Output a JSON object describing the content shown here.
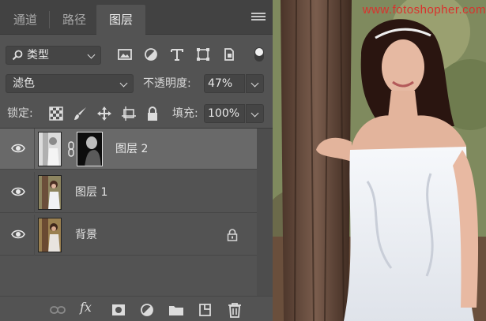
{
  "tabs": [
    {
      "label": "通道"
    },
    {
      "label": "路径"
    },
    {
      "label": "图层"
    }
  ],
  "filter": {
    "kind_label": "类型",
    "icons": [
      "image-filter-icon",
      "adjustment-filter-icon",
      "type-filter-icon",
      "shape-filter-icon",
      "smart-object-filter-icon",
      "filter-toggle-icon"
    ]
  },
  "blend": {
    "mode": "滤色",
    "opacity_label": "不透明度:",
    "opacity_value": "47%"
  },
  "lock": {
    "label": "锁定:",
    "fill_label": "填充:",
    "fill_value": "100%",
    "icons": [
      "lock-transparent-icon",
      "lock-image-icon",
      "lock-position-icon",
      "lock-artboard-icon",
      "lock-all-icon"
    ]
  },
  "layers": [
    {
      "name": "图层 2",
      "selected": true,
      "has_mask": true
    },
    {
      "name": "图层 1",
      "selected": false,
      "has_mask": false
    },
    {
      "name": "背景",
      "selected": false,
      "locked": true
    }
  ],
  "bottom_bar": {
    "icons": [
      "link-layers-icon",
      "fx-icon",
      "add-mask-icon",
      "adjustment-layer-icon",
      "new-group-icon",
      "new-layer-icon",
      "trash-icon"
    ],
    "fx_label": "fx"
  },
  "canvas": {
    "watermark": "www.fotoshopher.com"
  },
  "colors": {
    "panel_bg": "#535353",
    "tab_bar": "#424242",
    "selected_row": "#696969",
    "watermark": "#d9322d"
  }
}
